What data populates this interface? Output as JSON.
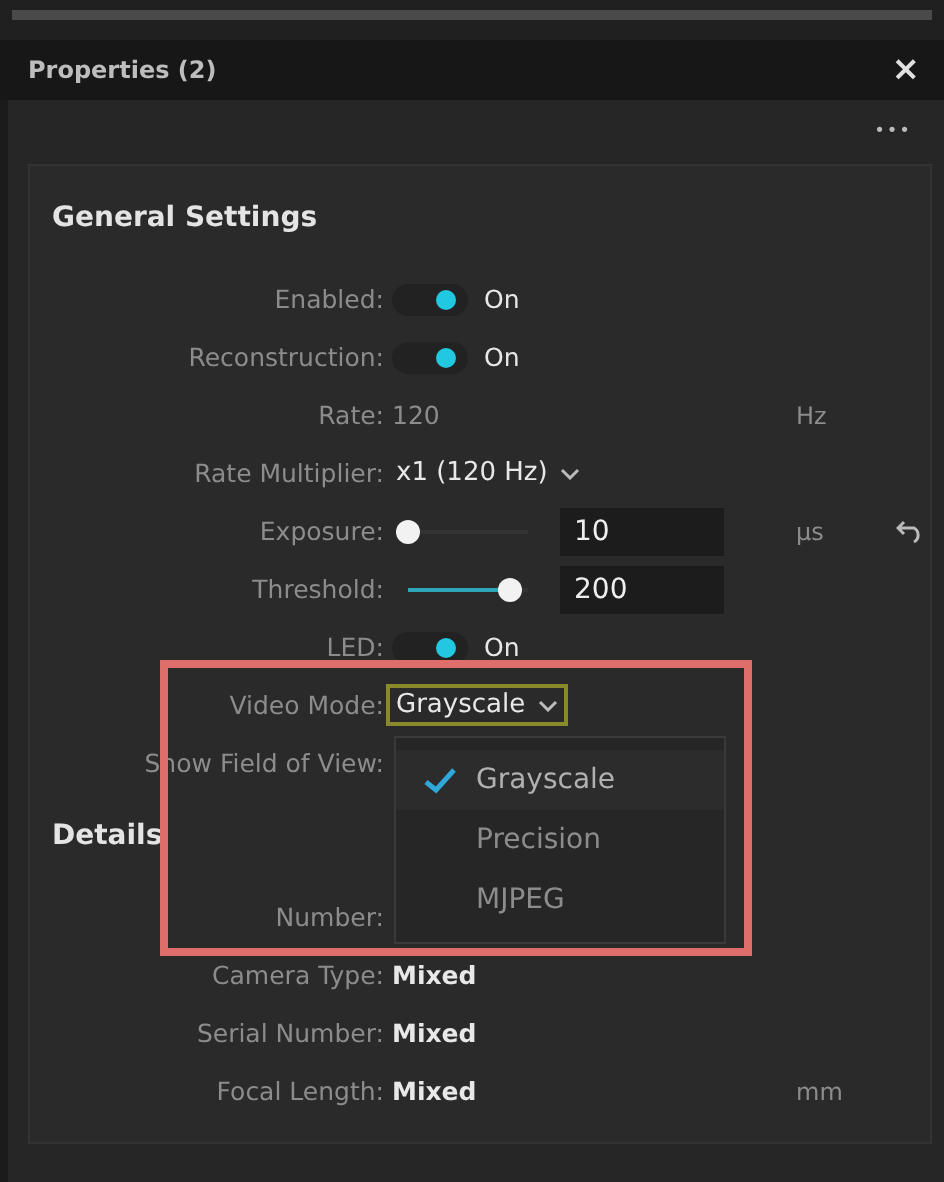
{
  "panel": {
    "title": "Properties (2)",
    "close": "×",
    "more": "•••"
  },
  "general": {
    "heading": "General Settings",
    "rows": [
      {
        "kind": "toggle",
        "label": "Enabled:",
        "on": true,
        "value": "On"
      },
      {
        "kind": "toggle",
        "label": "Reconstruction:",
        "on": true,
        "value": "On"
      },
      {
        "kind": "text",
        "label": "Rate:",
        "value": "120",
        "unit": "Hz"
      },
      {
        "kind": "select",
        "label": "Rate Multiplier:",
        "value": "x1 (120 Hz)",
        "focused": false
      },
      {
        "kind": "slider",
        "label": "Exposure:",
        "level": 0,
        "value": "10",
        "unit": "µs",
        "reset": true
      },
      {
        "kind": "slider",
        "label": "Threshold:",
        "level": 0.85,
        "value": "200"
      },
      {
        "kind": "toggle",
        "label": "LED:",
        "on": true,
        "value": "On"
      },
      {
        "kind": "select",
        "label": "Video Mode:",
        "value": "Grayscale",
        "focused": true
      },
      {
        "kind": "label",
        "label": "Show Field of View:"
      }
    ]
  },
  "menu": {
    "items": [
      {
        "label": "Grayscale",
        "selected": true
      },
      {
        "label": "Precision",
        "selected": false
      },
      {
        "label": "MJPEG",
        "selected": false
      }
    ]
  },
  "details": {
    "heading": "Details",
    "rows": [
      {
        "label": "Number:"
      },
      {
        "label": "Camera Type:",
        "value": "Mixed"
      },
      {
        "label": "Serial Number:",
        "value": "Mixed"
      },
      {
        "label": "Focal Length:",
        "value": "Mixed",
        "unit": "mm"
      }
    ]
  }
}
